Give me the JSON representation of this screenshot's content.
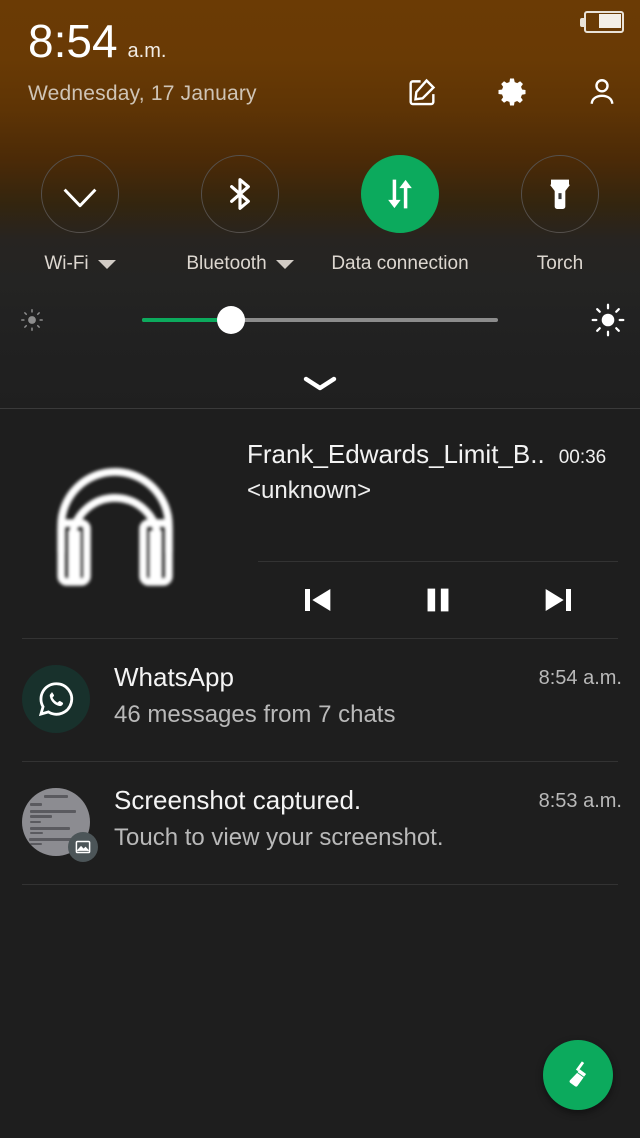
{
  "statusbar": {
    "battery_icon": "battery-icon",
    "battery_level_pct": 60
  },
  "header": {
    "time": "8:54",
    "ampm": "a.m.",
    "date": "Wednesday, 17 January",
    "icons": [
      {
        "name": "edit-icon",
        "label": "Edit"
      },
      {
        "name": "settings-gear-icon",
        "label": "Settings"
      },
      {
        "name": "user-profile-icon",
        "label": "User"
      }
    ]
  },
  "quick_settings": {
    "tiles": [
      {
        "label": "Wi-Fi",
        "icon": "wifi-icon",
        "active": false,
        "has_caret": true
      },
      {
        "label": "Bluetooth",
        "icon": "bluetooth-icon",
        "active": false,
        "has_caret": true
      },
      {
        "label": "Data connection",
        "icon": "data-connection-icon",
        "active": true,
        "has_caret": false
      },
      {
        "label": "Torch",
        "icon": "torch-icon",
        "active": false,
        "has_caret": false
      }
    ],
    "brightness": {
      "low_icon": "brightness-low-icon",
      "high_icon": "brightness-high-icon",
      "value_pct": 23
    },
    "expand_icon": "chevron-down-icon"
  },
  "notifications": {
    "media": {
      "album_art_icon": "headphones-icon",
      "title": "Frank_Edwards_Limit_B..",
      "time": "00:36",
      "artist": "<unknown>",
      "controls": [
        {
          "name": "previous-track-button",
          "icon": "skip-previous-icon"
        },
        {
          "name": "pause-button",
          "icon": "pause-icon"
        },
        {
          "name": "next-track-button",
          "icon": "skip-next-icon"
        }
      ]
    },
    "items": [
      {
        "app_icon": "whatsapp-icon",
        "title": "WhatsApp",
        "subtitle": "46 messages from 7 chats",
        "time": "8:54 a.m."
      },
      {
        "app_icon": "screenshot-thumbnail",
        "badge_icon": "image-icon",
        "title": "Screenshot captured.",
        "subtitle": "Touch to view your screenshot.",
        "time": "8:53 a.m."
      }
    ]
  },
  "clear_all": {
    "icon": "clear-all-brush-icon",
    "label": "Clear all notifications"
  },
  "colors": {
    "accent_green": "#0caa5d",
    "header_brown": "#6b3b05",
    "panel_dark": "#1e1e1e"
  }
}
